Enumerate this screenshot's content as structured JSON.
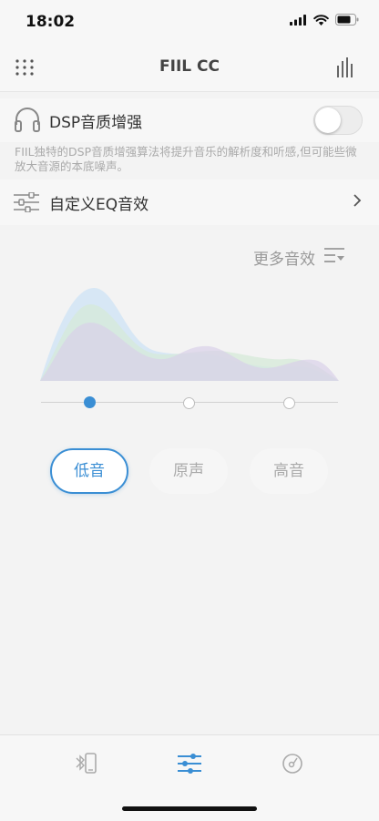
{
  "status": {
    "time": "18:02"
  },
  "nav": {
    "title": "FIIL CC"
  },
  "dsp": {
    "label": "DSP音质增强",
    "enabled": false,
    "description": "FIIL独特的DSP音质增强算法将提升音乐的解析度和听感,但可能些微放大音源的本底噪声。"
  },
  "eq": {
    "label": "自定义EQ音效"
  },
  "effects": {
    "more_label": "更多音效",
    "presets": [
      {
        "label": "低音",
        "active": true
      },
      {
        "label": "原声",
        "active": false
      },
      {
        "label": "高音",
        "active": false
      }
    ],
    "selected_index": 0
  },
  "tabs": [
    {
      "icon": "bluetooth-device-icon",
      "active": false
    },
    {
      "icon": "equalizer-sliders-icon",
      "active": true
    },
    {
      "icon": "music-disc-icon",
      "active": false
    }
  ],
  "colors": {
    "accent": "#3a8ed4",
    "background": "#f3f3f3"
  }
}
